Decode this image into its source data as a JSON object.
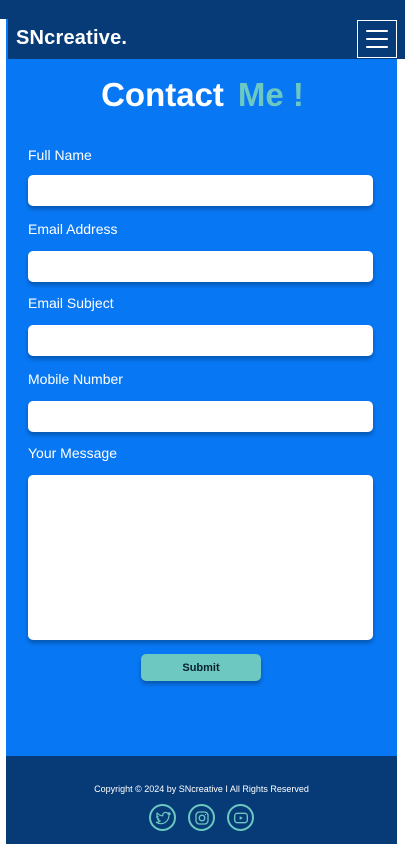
{
  "header": {
    "brand": "SNcreative.",
    "menu_icon": "hamburger-menu-icon"
  },
  "page": {
    "title_main": "Contact",
    "title_accent": "Me !"
  },
  "form": {
    "full_name_label": "Full Name",
    "email_label": "Email Address",
    "subject_label": "Email Subject",
    "mobile_label": "Mobile Number",
    "message_label": "Your Message",
    "submit_label": "Submit"
  },
  "footer": {
    "copyright": "Copyright © 2024 by SNcreative I All Rights Reserved",
    "socials": [
      "twitter-icon",
      "instagram-icon",
      "youtube-icon"
    ]
  },
  "colors": {
    "background": "#0877f3",
    "header_footer": "#073b78",
    "accent": "#6cc8c0",
    "text": "#ffffff"
  }
}
